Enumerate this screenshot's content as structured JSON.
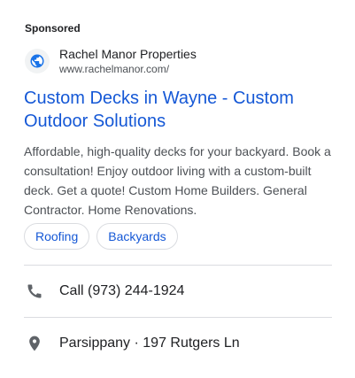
{
  "ad": {
    "sponsored_label": "Sponsored",
    "advertiser": {
      "name": "Rachel Manor Properties",
      "url": "www.rachelmanor.com/",
      "icon": "globe-icon"
    },
    "headline": "Custom Decks in Wayne - Custom Outdoor Solutions",
    "description": "Affordable, high-quality decks for your backyard. Book a consultation! Enjoy outdoor living with a custom-built deck. Get a quote! Custom Home Builders. General Contractor. Home Renovations.",
    "sitelinks": [
      {
        "label": "Roofing"
      },
      {
        "label": "Backyards"
      }
    ],
    "call": {
      "label": "Call (973) 244-1924",
      "icon": "phone-icon"
    },
    "location": {
      "label": "Parsippany · 197 Rutgers Ln",
      "icon": "location-pin-icon"
    }
  },
  "colors": {
    "link": "#1558d6",
    "text": "#202124",
    "secondary_text": "#4d5156",
    "icon_gray": "#5f6368",
    "favicon_blue": "#1a73e8",
    "divider": "#dadce0"
  }
}
